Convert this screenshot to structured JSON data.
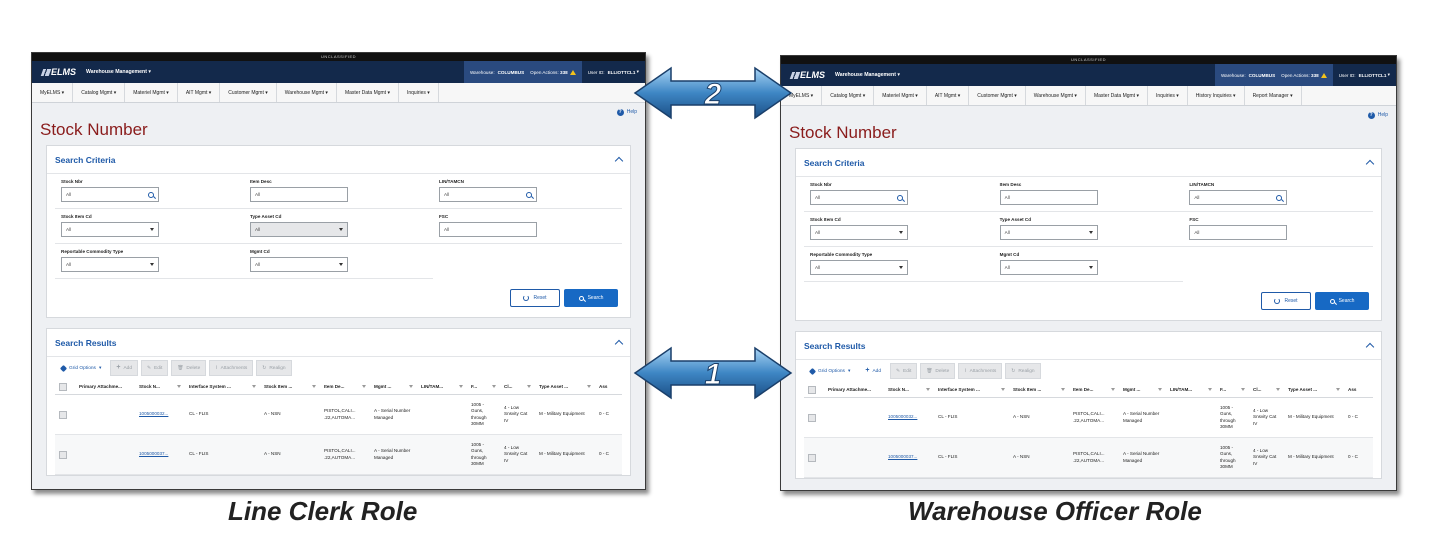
{
  "common": {
    "classification": "UNCLASSIFIED",
    "app_title": "Warehouse Management",
    "logo_text": "ELMS",
    "warehouse_label": "Warehouse:",
    "warehouse_value": "COLUMBUS",
    "open_actions_label": "Open Actions:",
    "open_actions_value": "338",
    "user_label": "User ID:",
    "user_value": "ELLIOTTCL1",
    "help": "Help",
    "page_title": "Stock Number",
    "search_criteria_title": "Search Criteria",
    "criteria": {
      "stock_nbr": {
        "label": "Stock Nbr",
        "value": "All"
      },
      "item_desc": {
        "label": "Item Desc",
        "value": "All"
      },
      "lin_tamcn": {
        "label": "LIN/TAMCN",
        "value": "All"
      },
      "stock_item_cd": {
        "label": "Stock Item Cd",
        "value": "All"
      },
      "type_asset_cd": {
        "label": "Type Asset Cd",
        "value": "All"
      },
      "fsc": {
        "label": "FSC",
        "value": "All"
      },
      "reportable_commodity_type": {
        "label": "Reportable Commodity Type",
        "value": "All"
      },
      "mgmt_cd": {
        "label": "Mgmt Cd",
        "value": "All"
      }
    },
    "reset_label": "Reset",
    "search_label": "Search",
    "search_results_title": "Search Results",
    "toolbar": {
      "grid_options": "Grid Options",
      "add": "Add",
      "edit": "Edit",
      "delete": "Delete",
      "attachments": "Attachments",
      "realign": "Realign"
    },
    "columns": [
      "Primary Attachme...",
      "Stock N...",
      "Interface System ...",
      "Stock Item ...",
      "Item De...",
      "Mgmt ...",
      "LIN/TAM...",
      "F...",
      "Cl...",
      "Type Asset ...",
      "Ass"
    ],
    "rows": [
      {
        "stock_nbr": "1005000032...",
        "interface_system": "CL - FLIS",
        "stock_item": "A - NSN",
        "item_desc": "PISTOL,CALI... .22,AUTOMA...",
        "mgmt": "A - Serial Number Managed",
        "lin_tamcn": "",
        "fsc": "1005 - Guns, through 30MM",
        "class": "4 - Low Snsvity Cat IV",
        "type_asset": "M - Military Equipment",
        "asset": "0 - C"
      },
      {
        "stock_nbr": "1005000037...",
        "interface_system": "CL - FLIS",
        "stock_item": "A - NSN",
        "item_desc": "PISTOL,CALI... .22,AUTOMA...",
        "mgmt": "A - Serial Number Managed",
        "lin_tamcn": "",
        "fsc": "1005 - Guns, through 30MM",
        "class": "4 - Low Snsvity Cat IV",
        "type_asset": "M - Military Equipment",
        "asset": "0 - C"
      }
    ]
  },
  "left_panel": {
    "menu": [
      "MyELMS",
      "Catalog Mgmt",
      "Materiel Mgmt",
      "AIT Mgmt",
      "Customer Mgmt",
      "Warehouse Mgmt",
      "Master Data Mgmt",
      "Inquiries"
    ],
    "caption": "Line Clerk Role"
  },
  "right_panel": {
    "menu": [
      "MyELMS",
      "Catalog Mgmt",
      "Materiel Mgmt",
      "AIT Mgmt",
      "Customer Mgmt",
      "Warehouse Mgmt",
      "Master Data Mgmt",
      "Inquiries",
      "History Inquiries",
      "Report Manager"
    ],
    "caption": "Warehouse Officer Role"
  },
  "callouts": {
    "one": "1",
    "two": "2"
  },
  "colors": {
    "topbar": "#13294b",
    "title_red": "#8a1c1c",
    "accent_blue": "#1f5aa8",
    "arrow_blue": "#3e86c4"
  }
}
